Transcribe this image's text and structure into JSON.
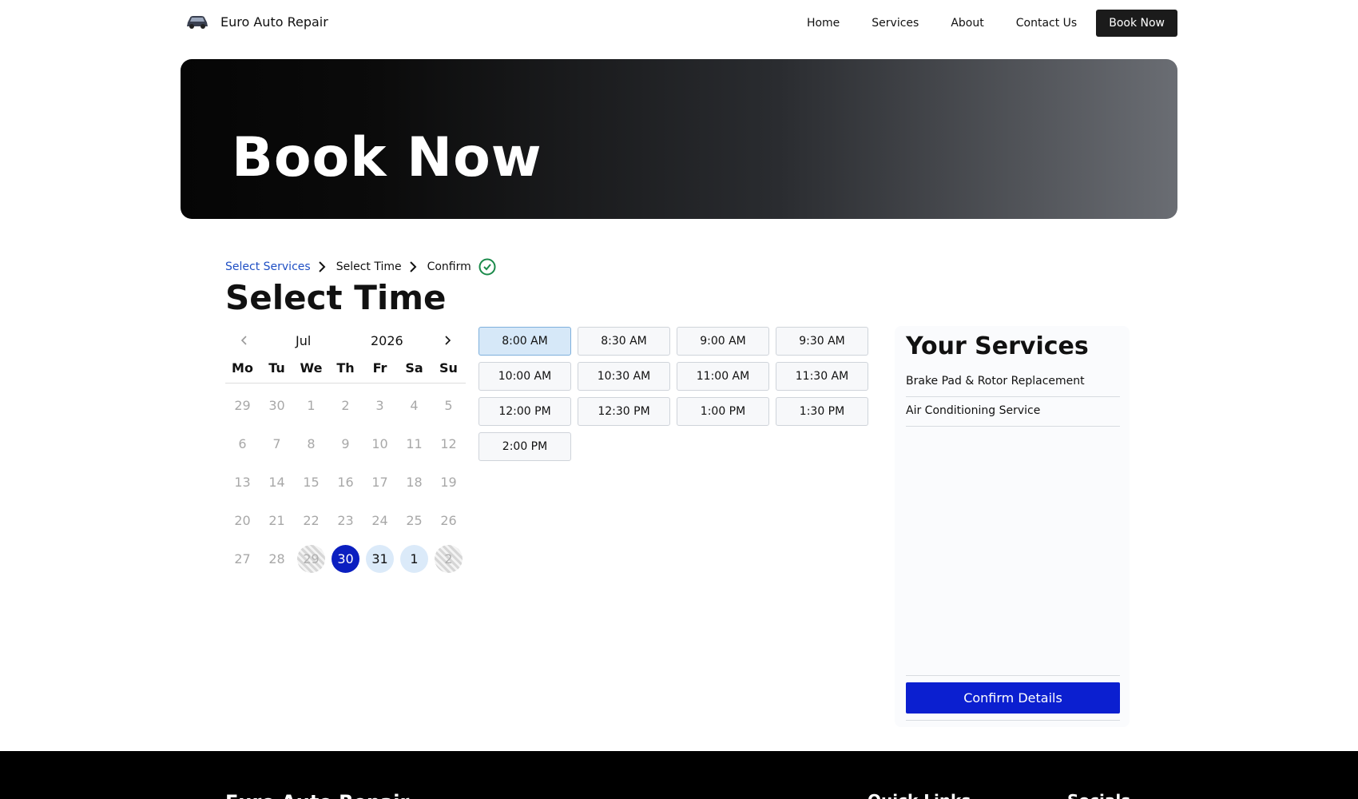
{
  "nav": {
    "brand": "Euro Auto Repair",
    "links": [
      "Home",
      "Services",
      "About",
      "Contact Us"
    ],
    "cta": "Book Now"
  },
  "hero": {
    "title": "Book Now"
  },
  "steps": {
    "items": [
      "Select Services",
      "Select Time",
      "Confirm"
    ],
    "active": "Select Services"
  },
  "page_title": "Select Time",
  "calendar": {
    "month": "Jul",
    "year": "2026",
    "weekdays": [
      "Mo",
      "Tu",
      "We",
      "Th",
      "Fr",
      "Sa",
      "Su"
    ],
    "days": [
      {
        "d": "29",
        "s": "muted"
      },
      {
        "d": "30",
        "s": "muted"
      },
      {
        "d": "1",
        "s": "muted"
      },
      {
        "d": "2",
        "s": "muted"
      },
      {
        "d": "3",
        "s": "muted"
      },
      {
        "d": "4",
        "s": "muted"
      },
      {
        "d": "5",
        "s": "muted"
      },
      {
        "d": "6",
        "s": "muted"
      },
      {
        "d": "7",
        "s": "muted"
      },
      {
        "d": "8",
        "s": "muted"
      },
      {
        "d": "9",
        "s": "muted"
      },
      {
        "d": "10",
        "s": "muted"
      },
      {
        "d": "11",
        "s": "muted"
      },
      {
        "d": "12",
        "s": "muted"
      },
      {
        "d": "13",
        "s": "muted"
      },
      {
        "d": "14",
        "s": "muted"
      },
      {
        "d": "15",
        "s": "muted"
      },
      {
        "d": "16",
        "s": "muted"
      },
      {
        "d": "17",
        "s": "muted"
      },
      {
        "d": "18",
        "s": "muted"
      },
      {
        "d": "19",
        "s": "muted"
      },
      {
        "d": "20",
        "s": "muted"
      },
      {
        "d": "21",
        "s": "muted"
      },
      {
        "d": "22",
        "s": "muted"
      },
      {
        "d": "23",
        "s": "muted"
      },
      {
        "d": "24",
        "s": "muted"
      },
      {
        "d": "25",
        "s": "muted"
      },
      {
        "d": "26",
        "s": "muted"
      },
      {
        "d": "27",
        "s": "muted"
      },
      {
        "d": "28",
        "s": "muted"
      },
      {
        "d": "29",
        "s": "striped"
      },
      {
        "d": "30",
        "s": "selected"
      },
      {
        "d": "31",
        "s": "avail"
      },
      {
        "d": "1",
        "s": "avail"
      },
      {
        "d": "2",
        "s": "striped"
      }
    ]
  },
  "times": {
    "slots": [
      "8:00 AM",
      "8:30 AM",
      "9:00 AM",
      "9:30 AM",
      "10:00 AM",
      "10:30 AM",
      "11:00 AM",
      "11:30 AM",
      "12:00 PM",
      "12:30 PM",
      "1:00 PM",
      "1:30 PM",
      "2:00 PM"
    ],
    "selected": "8:00 AM"
  },
  "services_panel": {
    "title": "Your Services",
    "items": [
      "Brake Pad & Rotor Replacement",
      "Air Conditioning Service"
    ],
    "confirm_label": "Confirm Details"
  },
  "footer": {
    "brand": "Euro Auto Repair",
    "quick_links_title": "Quick Links",
    "socials_title": "Socials"
  },
  "colors": {
    "accent": "#0b1fd0",
    "step_active": "#1f4fc4",
    "available_day": "#dbeaf9",
    "selected_slot": "#d6e8f8"
  },
  "icons": {
    "brand": "car-icon",
    "step_separator": "chevron-right-icon",
    "confirm_step": "check-circle-icon",
    "cal_prev": "chevron-left-icon",
    "cal_next": "chevron-right-icon"
  }
}
